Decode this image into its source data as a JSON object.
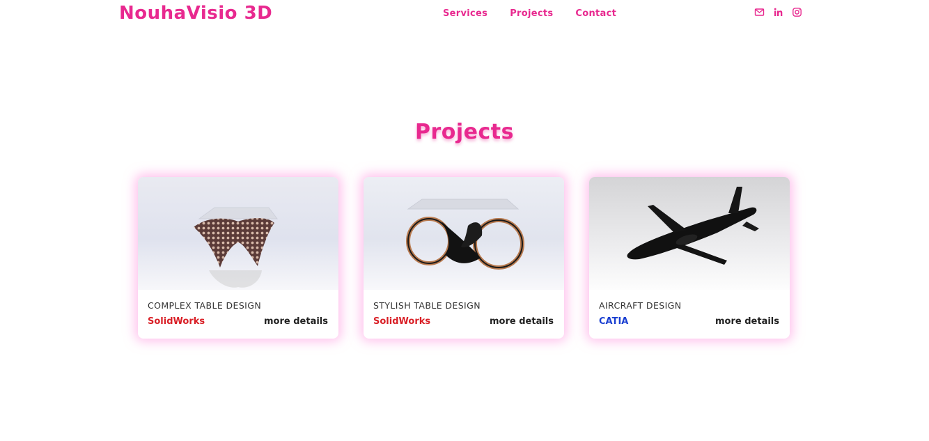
{
  "header": {
    "logo": "NouhaVisio 3D",
    "nav": [
      {
        "label": "Services"
      },
      {
        "label": "Projects"
      },
      {
        "label": "Contact"
      }
    ],
    "socials": [
      "mail-icon",
      "linkedin-icon",
      "instagram-icon"
    ],
    "accent_color": "#e8298f"
  },
  "projects": {
    "title": "Projects",
    "cards": [
      {
        "title": "COMPLEX TABLE DESIGN",
        "software": "SolidWorks",
        "more": "more details",
        "image": "table-mesh-image"
      },
      {
        "title": "STYLISH TABLE DESIGN",
        "software": "SolidWorks",
        "more": "more details",
        "image": "table-rings-image"
      },
      {
        "title": "AIRCRAFT DESIGN",
        "software": "CATIA",
        "more": "more details",
        "image": "aircraft-image"
      }
    ]
  },
  "colors": {
    "solidworks_gradient": [
      "#d91f26",
      "#f07c2a"
    ],
    "catia_gradient": [
      "#1a3fd1",
      "#2a86e8"
    ]
  }
}
